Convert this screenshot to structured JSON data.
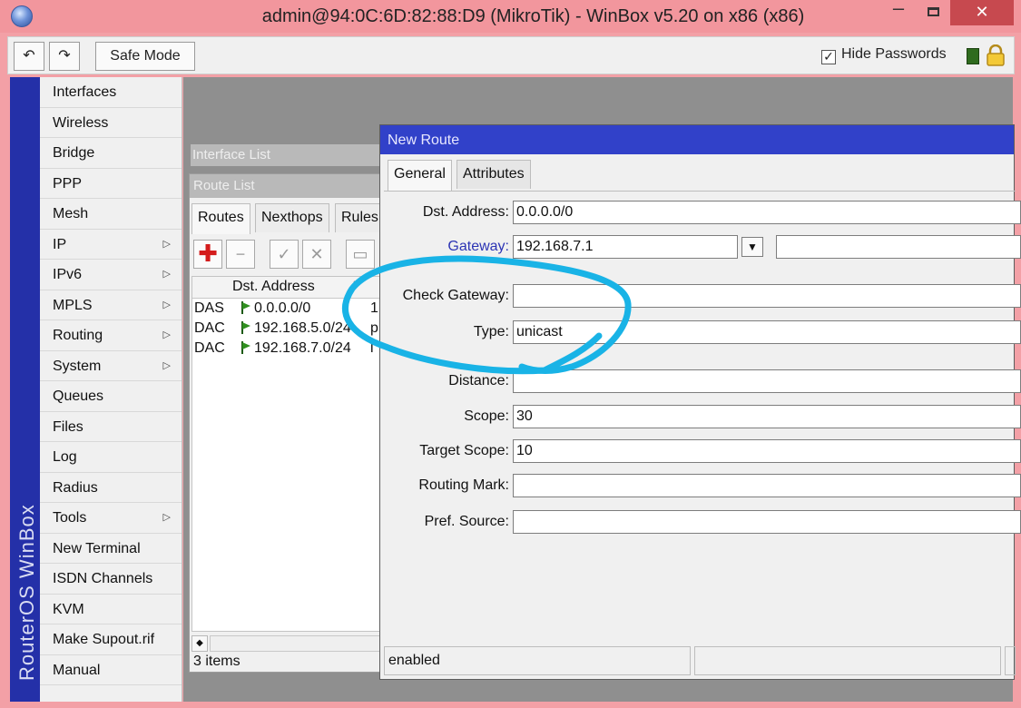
{
  "window": {
    "title": "admin@94:0C:6D:82:88:D9 (MikroTik) - WinBox v5.20 on x86 (x86)",
    "minimize": "–",
    "close": "✕"
  },
  "toolbar": {
    "undo": "↶",
    "redo": "↷",
    "safe_mode": "Safe Mode",
    "hide_passwords_label": "Hide Passwords",
    "hide_passwords_check": "✓",
    "status_color": "#2f6b1e"
  },
  "brand": "RouterOS WinBox",
  "sidebar": {
    "items": [
      {
        "label": "Interfaces",
        "arrow": ""
      },
      {
        "label": "Wireless",
        "arrow": ""
      },
      {
        "label": "Bridge",
        "arrow": ""
      },
      {
        "label": "PPP",
        "arrow": ""
      },
      {
        "label": "Mesh",
        "arrow": ""
      },
      {
        "label": "IP",
        "arrow": "▷"
      },
      {
        "label": "IPv6",
        "arrow": "▷"
      },
      {
        "label": "MPLS",
        "arrow": "▷"
      },
      {
        "label": "Routing",
        "arrow": "▷"
      },
      {
        "label": "System",
        "arrow": "▷"
      },
      {
        "label": "Queues",
        "arrow": ""
      },
      {
        "label": "Files",
        "arrow": ""
      },
      {
        "label": "Log",
        "arrow": ""
      },
      {
        "label": "Radius",
        "arrow": ""
      },
      {
        "label": "Tools",
        "arrow": "▷"
      },
      {
        "label": "New Terminal",
        "arrow": ""
      },
      {
        "label": "ISDN Channels",
        "arrow": ""
      },
      {
        "label": "KVM",
        "arrow": ""
      },
      {
        "label": "Make Supout.rif",
        "arrow": ""
      },
      {
        "label": "Manual",
        "arrow": ""
      }
    ]
  },
  "interface_list": {
    "title": "Interface List"
  },
  "route_list": {
    "title": "Route List",
    "tabs": [
      "Routes",
      "Nexthops",
      "Rules"
    ],
    "buttons": {
      "add": "✚",
      "remove": "−",
      "enable": "✓",
      "disable": "✕",
      "comment": "▭"
    },
    "header": {
      "dst": "Dst. Address",
      "sort": "/"
    },
    "rows": [
      {
        "flags": "DAS",
        "dst": "0.0.0.0/0",
        "extra": "1"
      },
      {
        "flags": "DAC",
        "dst": "192.168.5.0/24",
        "extra": "p"
      },
      {
        "flags": "DAC",
        "dst": "192.168.7.0/24",
        "extra": "l"
      }
    ],
    "scroll_arrow": "◆",
    "count": "3 items"
  },
  "new_route": {
    "title": "New Route",
    "tabs": [
      "General",
      "Attributes"
    ],
    "fields": [
      {
        "label": "Dst. Address:",
        "value": "0.0.0.0/0"
      },
      {
        "label": "Gateway:",
        "value": "192.168.7.1",
        "dropdown": "▼"
      },
      {
        "label": "Check Gateway:",
        "value": ""
      },
      {
        "label": "Type:",
        "value": "unicast"
      },
      {
        "label": "Distance:",
        "value": ""
      },
      {
        "label": "Scope:",
        "value": "30"
      },
      {
        "label": "Target Scope:",
        "value": "10"
      },
      {
        "label": "Routing Mark:",
        "value": ""
      },
      {
        "label": "Pref. Source:",
        "value": ""
      }
    ],
    "status": "enabled"
  },
  "annotation_color": "#19b3e6"
}
